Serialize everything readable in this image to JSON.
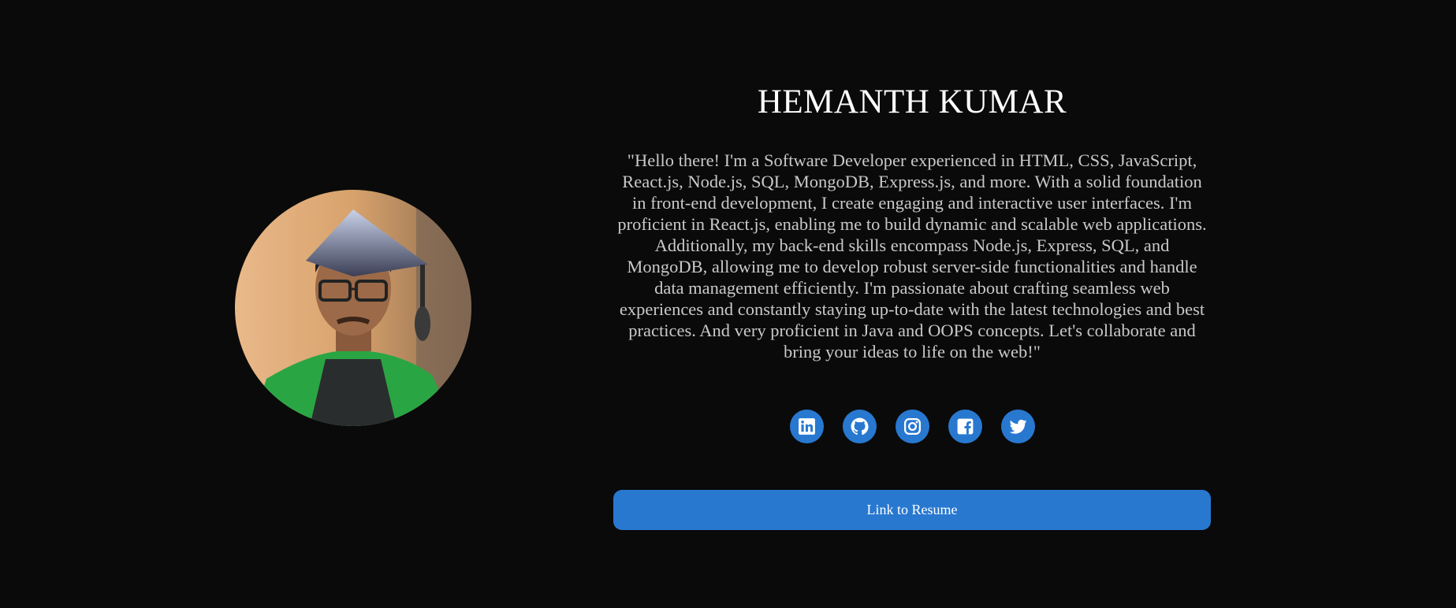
{
  "profile": {
    "name": "HEMANTH KUMAR",
    "bio": "\"Hello there! I'm a Software Developer experienced in HTML, CSS, JavaScript, React.js, Node.js, SQL, MongoDB, Express.js, and more. With a solid foundation in front-end development, I create engaging and interactive user interfaces. I'm proficient in React.js, enabling me to build dynamic and scalable web applications. Additionally, my back-end skills encompass Node.js, Express, SQL, and MongoDB, allowing me to develop robust server-side functionalities and handle data management efficiently. I'm passionate about crafting seamless web experiences and constantly staying up-to-date with the latest technologies and best practices. And very proficient in Java and OOPS concepts. Let's collaborate and bring your ideas to life on the web!\""
  },
  "socials": [
    {
      "icon": "linkedin-icon"
    },
    {
      "icon": "github-icon"
    },
    {
      "icon": "instagram-icon"
    },
    {
      "icon": "facebook-icon"
    },
    {
      "icon": "twitter-icon"
    }
  ],
  "resume": {
    "label": "Link to Resume"
  },
  "colors": {
    "background": "#0a0a0a",
    "accent": "#2878d0",
    "name": "#ffffff",
    "bio": "#c9c9c9"
  }
}
